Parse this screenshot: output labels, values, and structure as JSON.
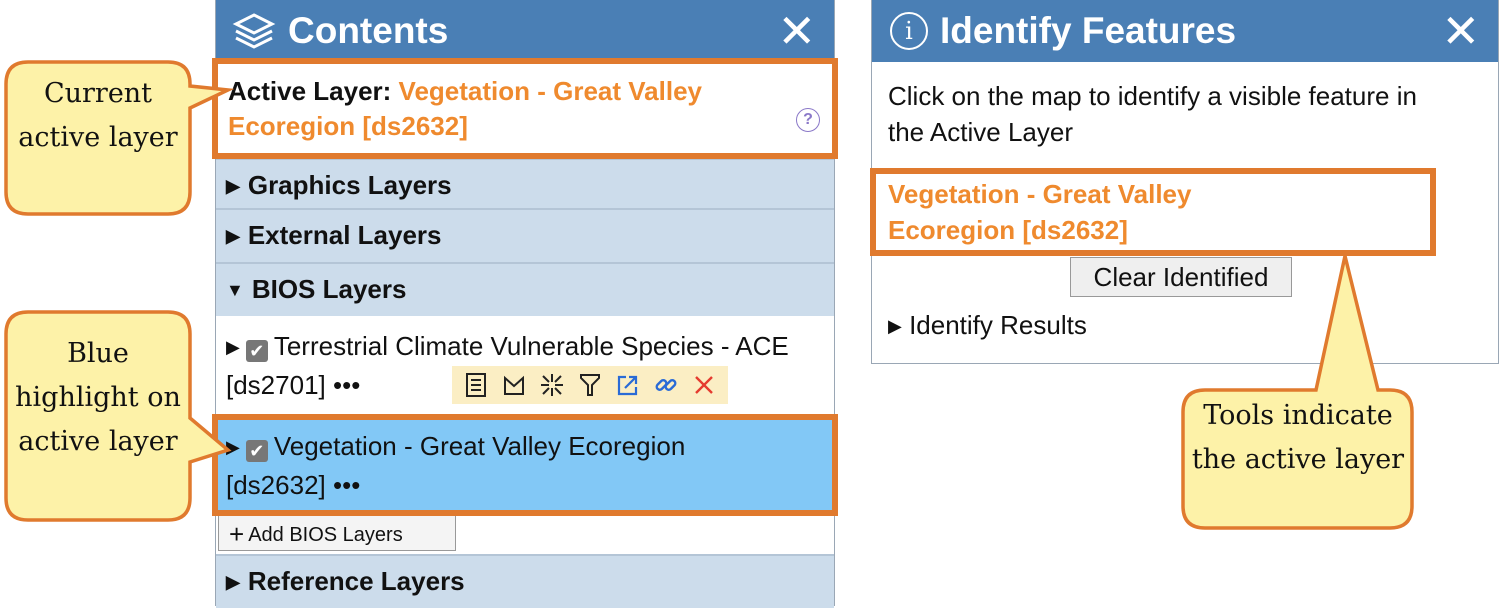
{
  "contents": {
    "title": "Contents",
    "close": "✕",
    "active_layer_label": "Active Layer:",
    "active_layer_name": "Vegetation - Great Valley Ecoregion [ds2632]",
    "help": "?",
    "groups": {
      "graphics": "Graphics Layers",
      "external": "External Layers",
      "bios": "BIOS Layers",
      "reference": "Reference Layers"
    },
    "layers": [
      {
        "name": "Terrestrial Climate Vulnerable Species - ACE [ds2701]",
        "more": "•••"
      },
      {
        "name": "Vegetation - Great Valley Ecoregion [ds2632]",
        "more": "•••"
      }
    ],
    "tools": [
      "table-icon",
      "legend-icon",
      "zoom-to-icon",
      "filter-icon",
      "open-icon",
      "link-icon",
      "remove-icon"
    ],
    "add_button": "Add BIOS Layers"
  },
  "identify": {
    "title": "Identify Features",
    "close": "✕",
    "instruction": "Click on the map to identify a visible feature in the Active Layer",
    "layer": "Vegetation - Great Valley Ecoregion [ds2632]",
    "clear_button": "Clear Identified",
    "results": "Identify Results"
  },
  "callouts": {
    "active": "Current active layer",
    "blue": "Blue highlight on active layer",
    "tools": "Tools indicate the active layer"
  },
  "colors": {
    "header": "#4a7fb5",
    "group_bg": "#ccdceb",
    "active_row": "#82c8f6",
    "highlight": "#e07a2e",
    "orange_text": "#ef8a2e",
    "callout_fill": "#fdf2a8",
    "toolbar_bg": "#fbeec4"
  }
}
